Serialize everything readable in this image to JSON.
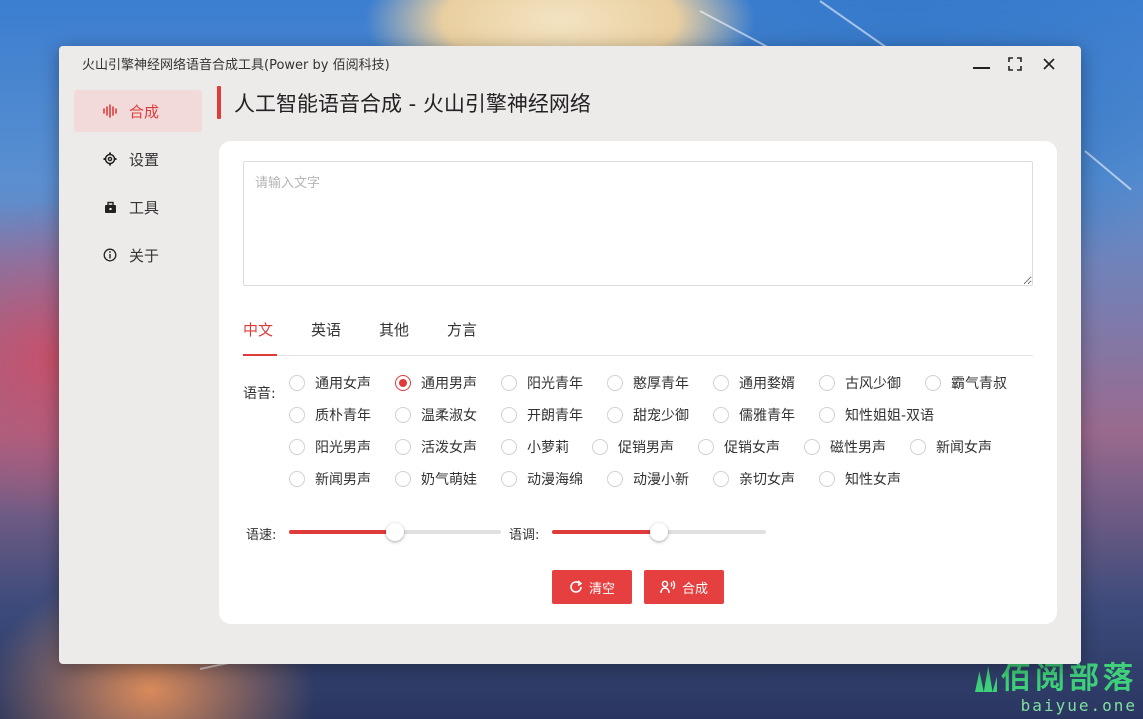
{
  "window": {
    "title": "火山引擎神经网络语音合成工具(Power by 佰阅科技)"
  },
  "sidebar": {
    "items": [
      {
        "label": "合成",
        "icon": "waveform-icon",
        "active": true
      },
      {
        "label": "设置",
        "icon": "gear-icon",
        "active": false
      },
      {
        "label": "工具",
        "icon": "toolbox-icon",
        "active": false
      },
      {
        "label": "关于",
        "icon": "info-icon",
        "active": false
      }
    ]
  },
  "header": {
    "title": "人工智能语音合成 - 火山引擎神经网络"
  },
  "input": {
    "placeholder": "请输入文字",
    "value": ""
  },
  "tabs": [
    {
      "label": "中文",
      "active": true
    },
    {
      "label": "英语",
      "active": false
    },
    {
      "label": "其他",
      "active": false
    },
    {
      "label": "方言",
      "active": false
    }
  ],
  "voice": {
    "label": "语音:",
    "selected": "通用男声",
    "rows": [
      [
        "通用女声",
        "通用男声",
        "阳光青年",
        "憨厚青年",
        "通用婺婿",
        "古风少御",
        "霸气青叔"
      ],
      [
        "质朴青年",
        "温柔淑女",
        "开朗青年",
        "甜宠少御",
        "儒雅青年",
        "知性姐姐-双语"
      ],
      [
        "阳光男声",
        "活泼女声",
        "小萝莉",
        "促销男声",
        "促销女声",
        "磁性男声",
        "新闻女声"
      ],
      [
        "新闻男声",
        "奶气萌娃",
        "动漫海绵",
        "动漫小新",
        "亲切女声",
        "知性女声"
      ]
    ]
  },
  "sliders": {
    "speed": {
      "label": "语速:",
      "value": 0.5
    },
    "pitch": {
      "label": "语调:",
      "value": 0.5
    }
  },
  "buttons": {
    "clear": "清空",
    "synthesize": "合成"
  },
  "colors": {
    "accent": "#e03b3b",
    "active_nav_bg": "#f2dada"
  },
  "watermark": {
    "cn": "佰阅部落",
    "en": "baiyue.one"
  }
}
